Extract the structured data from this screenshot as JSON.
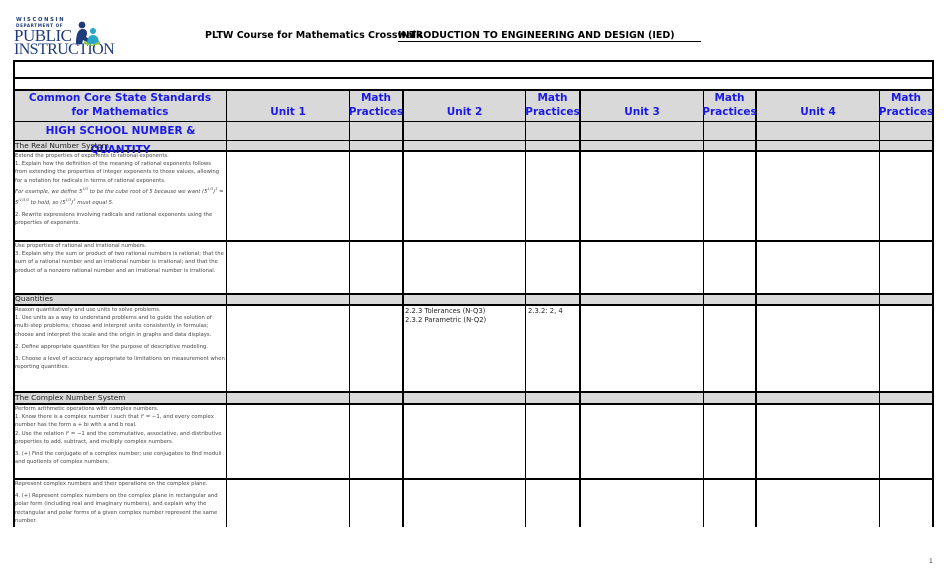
{
  "header": {
    "logo": {
      "line1": "WISCONSIN",
      "line2": "DEPARTMENT OF",
      "line3": "PUBLIC",
      "line4": "INSTRUCTION",
      "icon": "reading-family-icon"
    },
    "title": "PLTW Course for Mathematics Crosswalk",
    "course": "INTRODUCTION TO ENGINEERING AND DESIGN (IED)"
  },
  "colors": {
    "header_text": "#1a1ae6",
    "band_gray": "#d9d9d9",
    "logo_blue": "#1f3b7a",
    "logo_teal": "#2aa6c9",
    "logo_green": "#8dc63f"
  },
  "table": {
    "columns": [
      "Common Core State Standards for Mathematics",
      "Unit 1",
      "Math Practices",
      "Unit 2",
      "Math Practices",
      "Unit 3",
      "Math Practices",
      "Unit 4",
      "Math Practices"
    ],
    "category": "HIGH SCHOOL NUMBER & QUANTITY",
    "sections": [
      {
        "title": "The Real Number System",
        "blocks": [
          {
            "cluster": "Extend the properties of exponents to rational exponents.",
            "standards": [
              "1. Explain how the definition of the meaning of rational exponents follows from extending the properties of integer exponents to those values, allowing for a notation for radicals in terms of rational exponents.",
              "For example, we define 5^(1/3) to be the cube root of 5 because we want (5^(1/3))^3 = 5^((1/3)3) to hold, so (5^(1/3))^3 must equal 5.",
              "2. Rewrite expressions involving radicals and rational exponents using the properties of exponents."
            ],
            "unit1": "",
            "mp1": "",
            "unit2": "",
            "mp2": "",
            "unit3": "",
            "mp3": "",
            "unit4": "",
            "mp4": ""
          },
          {
            "cluster": "Use properties of rational and irrational numbers.",
            "standards": [
              "3. Explain why the sum or product of two rational numbers is rational; that the sum of a rational number and an irrational number is irrational; and that the product of a nonzero rational number and an irrational number is irrational."
            ],
            "unit1": "",
            "mp1": "",
            "unit2": "",
            "mp2": "",
            "unit3": "",
            "mp3": "",
            "unit4": "",
            "mp4": ""
          }
        ]
      },
      {
        "title": "Quantities",
        "blocks": [
          {
            "cluster": "Reason quantitatively and use units to solve problems.",
            "standards": [
              "1. Use units as a way to understand problems and to guide the solution of multi-step problems; choose and interpret units consistently in formulas; choose and interpret the scale and the origin in graphs and data displays.",
              "2. Define appropriate quantities for the purpose of descriptive modeling.",
              "3. Choose a level of accuracy appropriate to limitations on measurement when reporting quantities."
            ],
            "unit1": "",
            "mp1": "",
            "unit2_lines": [
              "2.2.3 Tolerances (N-Q3)",
              "2.3.2 Parametric (N-Q2)"
            ],
            "mp2": "2.3.2: 2, 4",
            "unit3": "",
            "mp3": "",
            "unit4": "",
            "mp4": ""
          }
        ]
      },
      {
        "title": "The Complex Number System",
        "blocks": [
          {
            "cluster": "Perform arithmetic operations with complex numbers.",
            "standards": [
              "1. Know there is a complex number i such that i² = −1, and every complex number has the form a + bi with a and b real.",
              "2. Use the relation i² = −1 and the commutative, associative, and distributive properties to add, subtract, and multiply complex numbers.",
              "3. (+) Find the conjugate of a complex number; use conjugates to find moduli and quotients of complex numbers."
            ],
            "unit1": "",
            "mp1": "",
            "unit2": "",
            "mp2": "",
            "unit3": "",
            "mp3": "",
            "unit4": "",
            "mp4": ""
          },
          {
            "cluster": "Represent complex numbers and their operations on the complex plane.",
            "standards": [
              "4. (+) Represent complex numbers on the complex plane in rectangular and polar form (including real and imaginary numbers), and explain why the rectangular and polar forms of a given complex number represent the same number."
            ],
            "unit1": "",
            "mp1": "",
            "unit2": "",
            "mp2": "",
            "unit3": "",
            "mp3": "",
            "unit4": "",
            "mp4": ""
          }
        ]
      }
    ]
  },
  "footer": {
    "page_number": "1"
  }
}
